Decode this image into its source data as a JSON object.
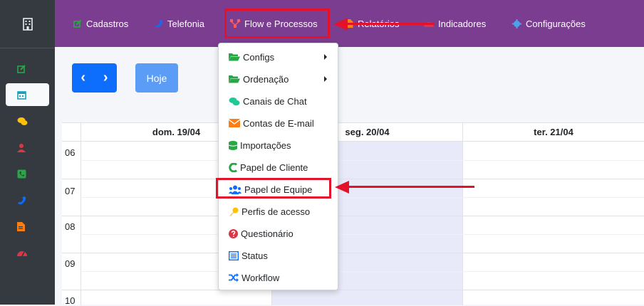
{
  "nav": [
    {
      "label": "Cadastros",
      "icon": "edit-icon"
    },
    {
      "label": "Telefonia",
      "icon": "phone-icon"
    },
    {
      "label": "Flow e Processos",
      "icon": "flow-icon"
    },
    {
      "label": "Relatórios",
      "icon": "file-icon"
    },
    {
      "label": "Indicadores",
      "icon": "gauge-icon"
    },
    {
      "label": "Configurações",
      "icon": "gear-icon"
    }
  ],
  "toolbar": {
    "prev": "‹",
    "next": "›",
    "today": "Hoje"
  },
  "calendar": {
    "columns": [
      "dom. 19/04",
      "seg. 20/04",
      "ter. 21/04"
    ],
    "hours": [
      "06",
      "07",
      "08",
      "09",
      "10"
    ]
  },
  "menu": [
    {
      "label": "Configs",
      "icon": "folder-open-icon",
      "submenu": true
    },
    {
      "label": "Ordenação",
      "icon": "folder-open-icon",
      "submenu": true
    },
    {
      "label": "Canais de Chat",
      "icon": "chat-icon",
      "submenu": false
    },
    {
      "label": "Contas de E-mail",
      "icon": "envelope-icon",
      "submenu": false
    },
    {
      "label": "Importações",
      "icon": "database-icon",
      "submenu": false
    },
    {
      "label": "Papel de Cliente",
      "icon": "c-icon",
      "submenu": false
    },
    {
      "label": "Papel de Equipe",
      "icon": "users-icon",
      "submenu": false
    },
    {
      "label": "Perfis de acesso",
      "icon": "key-icon",
      "submenu": false
    },
    {
      "label": "Questionário",
      "icon": "question-icon",
      "submenu": false
    },
    {
      "label": "Status",
      "icon": "list-icon",
      "submenu": false
    },
    {
      "label": "Workflow",
      "icon": "shuffle-icon",
      "submenu": false
    }
  ],
  "colors": {
    "topbar": "#7a3d8f",
    "sidebar": "#343a40",
    "highlight": "#e3122a",
    "primary": "#0d6efd"
  }
}
